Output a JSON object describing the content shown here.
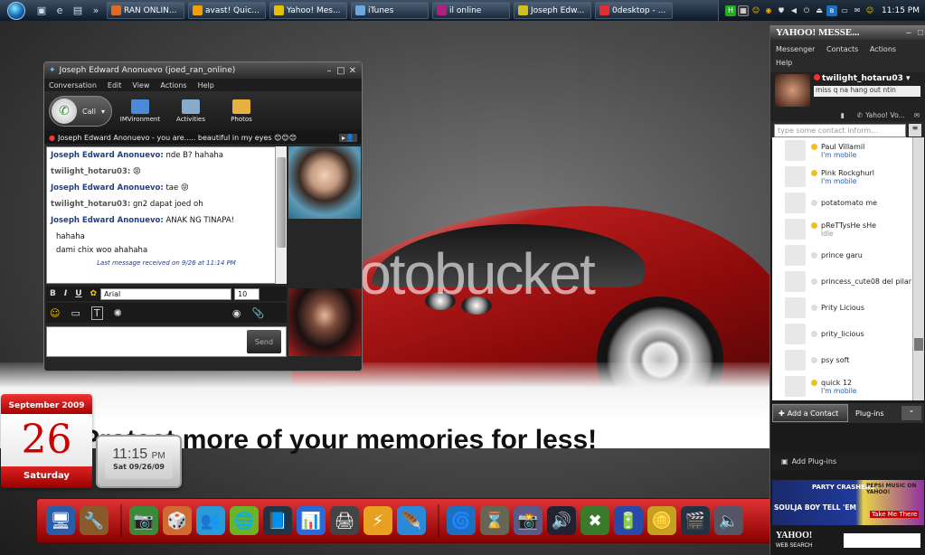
{
  "taskbar": {
    "quick_launch": [
      "desktop-icon",
      "ie-icon",
      "folder-icon"
    ],
    "overflow": "»",
    "buttons": [
      {
        "label": "RAN ONLIN...",
        "color": "#e06a20"
      },
      {
        "label": "avast! Quic...",
        "color": "#f0a000"
      },
      {
        "label": "Yahoo! Mes...",
        "color": "#e8c000"
      },
      {
        "label": "iTunes",
        "color": "#6aa8e0"
      },
      {
        "label": "il online",
        "color": "#b02080"
      },
      {
        "label": "Joseph Edw...",
        "color": "#d0c020"
      },
      {
        "label": "0desktop - ...",
        "color": "#e03030"
      }
    ],
    "clock": "11:15 PM"
  },
  "desktop": {
    "watermark": "photobucket",
    "banner": "Protect more of your memories for less!"
  },
  "chat": {
    "title": "Joseph Edward Anonuevo (joed_ran_online)",
    "menu": [
      "Conversation",
      "Edit",
      "View",
      "Actions",
      "Help"
    ],
    "call_label": "Call",
    "tools": [
      {
        "label": "IMVironment",
        "color": "#4a8ad8"
      },
      {
        "label": "Activities",
        "color": "#88aacc"
      },
      {
        "label": "Photos",
        "color": "#e8b040"
      }
    ],
    "status": "Joseph Edward Anonuevo - you are..... beautiful in my eyes 😊😊😊",
    "messages": [
      {
        "who": "Joseph Edward Anonuevo:",
        "text": " nde B? hahaha",
        "me": true
      },
      {
        "who": "twilight_hotaru03:",
        "text": " 😡",
        "me": false
      },
      {
        "who": "Joseph Edward Anonuevo:",
        "text": " tae 😝",
        "me": true
      },
      {
        "who": "twilight_hotaru03:",
        "text": " gn2 dapat joed oh",
        "me": false
      },
      {
        "who": "Joseph Edward Anonuevo:",
        "text": " ANAK NG TINAPA!",
        "me": true
      }
    ],
    "plain_lines": [
      "hahaha",
      "dami chix woo ahahaha"
    ],
    "last_received": "Last message received on 9/26 at 11:14 PM",
    "format": {
      "font": "Arial",
      "size": "10"
    },
    "send_label": "Send"
  },
  "calendar": {
    "month": "September 2009",
    "day": "26",
    "weekday": "Saturday"
  },
  "clock_widget": {
    "time": "11:15",
    "ampm": "PM",
    "date": "Sat 09/26/09"
  },
  "dock": {
    "items": [
      {
        "name": "computer-icon",
        "glyph": "🖥"
      },
      {
        "name": "tools-icon",
        "glyph": "🔧"
      },
      {
        "name": "webcam-icon",
        "glyph": "📷"
      },
      {
        "name": "dice-icon",
        "glyph": "🎲"
      },
      {
        "name": "messenger-icon",
        "glyph": "👥"
      },
      {
        "name": "globe-icon",
        "glyph": "🌐"
      },
      {
        "name": "book-icon",
        "glyph": "📘"
      },
      {
        "name": "chart-icon",
        "glyph": "📊"
      },
      {
        "name": "printer-icon",
        "glyph": "🖨"
      },
      {
        "name": "winamp-icon",
        "glyph": "⚡"
      },
      {
        "name": "feather-icon",
        "glyph": "🪶"
      },
      {
        "name": "ie-icon",
        "glyph": "🌀"
      },
      {
        "name": "hourglass-icon",
        "glyph": "⌛"
      },
      {
        "name": "camera-icon",
        "glyph": "📸"
      },
      {
        "name": "speaker-icon",
        "glyph": "🔊"
      },
      {
        "name": "excel-icon",
        "glyph": "✖"
      },
      {
        "name": "battery-icon",
        "glyph": "🔋"
      },
      {
        "name": "coin-icon",
        "glyph": "🪙"
      },
      {
        "name": "video-icon",
        "glyph": "🎬"
      },
      {
        "name": "sound-icon",
        "glyph": "🔈"
      }
    ]
  },
  "yahoo": {
    "title": "YAHOO! MESSE...",
    "menu": [
      "Messenger",
      "Contacts",
      "Actions",
      "Help"
    ],
    "user": "twilight_hotaru03",
    "status_msg": "miss q na hang out ntin",
    "tool_label": "Yahoo! Vo...",
    "search_placeholder": "type some contact inform...",
    "contacts": [
      {
        "name": "Paul Villamil",
        "sub": "I'm mobile",
        "status": "#f0c020"
      },
      {
        "name": "Pink Rockghurl",
        "sub": "I'm mobile",
        "status": "#f0c020"
      },
      {
        "name": "potatomato me",
        "sub": "",
        "status": "#ddd"
      },
      {
        "name": "pReTTysHe sHe",
        "sub": "Idle",
        "status": "#f0c020"
      },
      {
        "name": "prince garu",
        "sub": "",
        "status": "#ddd"
      },
      {
        "name": "princess_cute08 del pilar",
        "sub": "",
        "status": "#ddd"
      },
      {
        "name": "Prity Licious",
        "sub": "",
        "status": "#ddd"
      },
      {
        "name": "prity_licious",
        "sub": "",
        "status": "#ddd"
      },
      {
        "name": "psy soft",
        "sub": "",
        "status": "#ddd"
      },
      {
        "name": "quick 12",
        "sub": "I'm mobile",
        "status": "#f0c020"
      }
    ],
    "add_contact": "Add a Contact",
    "plugins": "Plug-ins",
    "add_plugins": "Add Plug-ins",
    "ad": {
      "line1": "PARTY CRASHERS",
      "line2": "SOULJA BOY TELL 'EM",
      "line3": "PEPSI MUSIC ON YAHOO!",
      "line4": "Take Me There"
    },
    "web_search": "YAHOO!",
    "web_search_sub": "WEB SEARCH"
  }
}
